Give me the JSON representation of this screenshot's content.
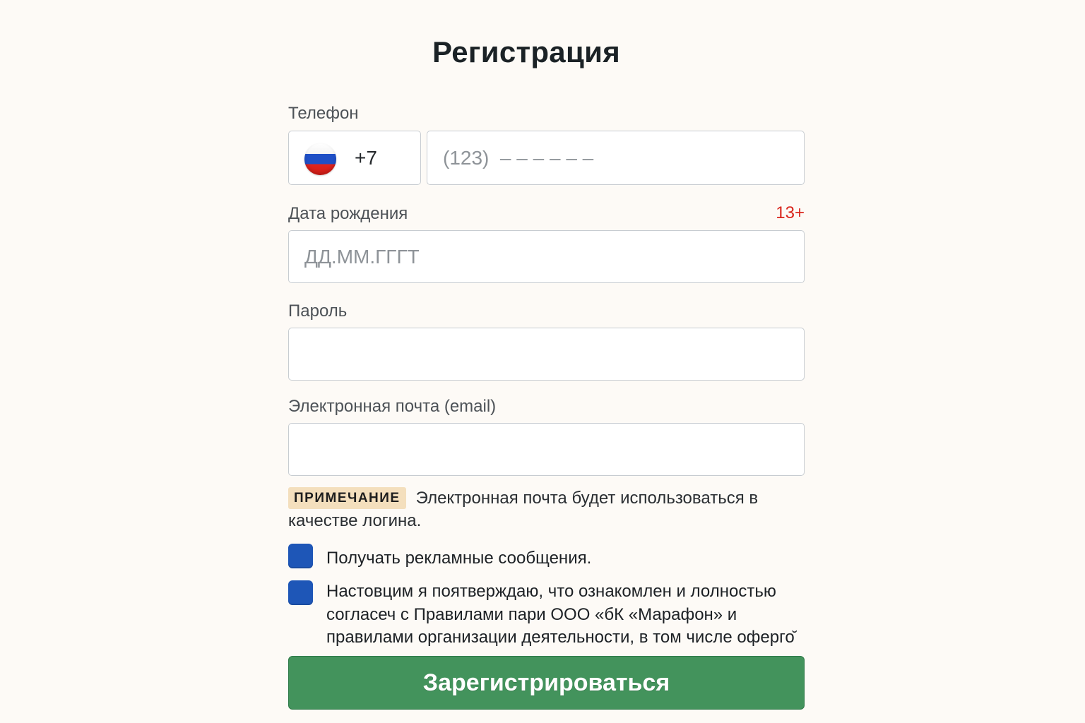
{
  "form": {
    "title": "Регистрация",
    "phone": {
      "label": "Телефон",
      "country_code": "+7",
      "flag_icon": "russia-flag-icon",
      "placeholder": "(123)  – – – – – –"
    },
    "birthdate": {
      "label": "Дата рождения",
      "age_badge": "13+",
      "placeholder": "ДД.ММ.ГГГТ"
    },
    "password": {
      "label": "Пароль",
      "value": ""
    },
    "email": {
      "label": "Электронная почта (email)",
      "value": ""
    },
    "note": {
      "tag": "ПРИМЕЧАНИЕ",
      "text": "Электронная почта будет использоваться в качестве логина."
    },
    "checkboxes": [
      {
        "label": "Получать рекламные сообщения."
      },
      {
        "label": "Настовцим я поятверждаю, что ознакомлен и лолностью согласеч с Правилами пари ООО «бК «Марафон» и правилами организации деятельности, в том числе оферго̆"
      }
    ],
    "submit_label": "Зарегистрироваться"
  },
  "colors": {
    "background": "#fdfaf6",
    "accent_green": "#43935c",
    "checkbox_blue": "#1e56b7",
    "age_badge_red": "#d9251c",
    "note_tag_bg": "#f4dfbd"
  }
}
